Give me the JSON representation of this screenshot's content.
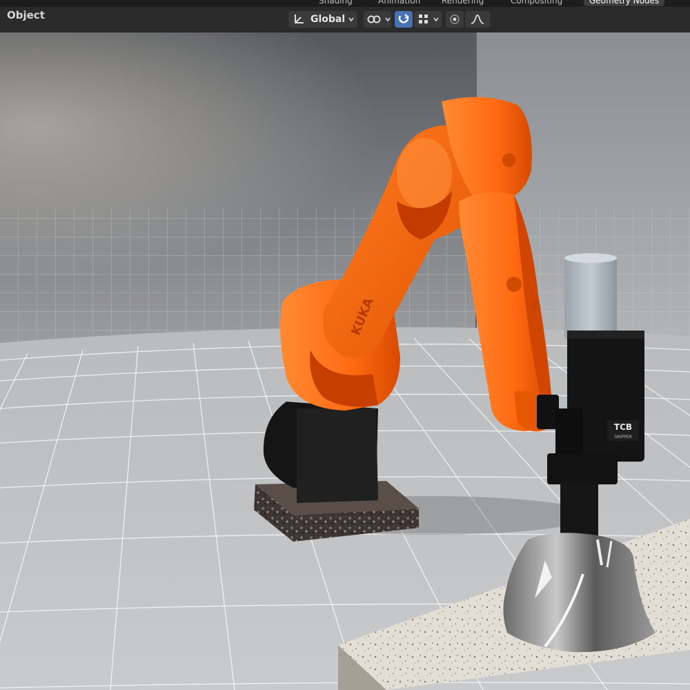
{
  "workspace_tabs": [
    {
      "label": "Shading",
      "active": false
    },
    {
      "label": "Animation",
      "active": false
    },
    {
      "label": "Rendering",
      "active": false
    },
    {
      "label": "Compositing",
      "active": false
    },
    {
      "label": "Geometry Nodes",
      "active": true
    }
  ],
  "header": {
    "mode": "Object",
    "orientation": "Global"
  },
  "viewport": {
    "gripper_label_line1": "TCB",
    "gripper_label_line2": "GRIPPER",
    "robot_arm_lettering": "KUKA"
  },
  "colors": {
    "robot_orange": "#ff6a12",
    "snap_active": "#4772b3",
    "header_bg": "#2b2b2b"
  }
}
